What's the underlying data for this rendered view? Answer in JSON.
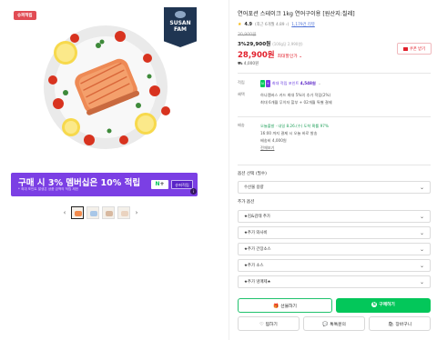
{
  "gallery": {
    "super_badge": "슈퍼적립",
    "brand_line1": "SUSAN",
    "brand_line2": "FAM",
    "promo": {
      "main": "구매 시 3% 멤버십은 10% 적립",
      "sub": "* 최대 포인트 발생은 상품 금액의 적립 제한",
      "n_label": "N",
      "plus_label": "+",
      "chip": "슈퍼적립",
      "info": "i"
    },
    "prev_arrow": "‹",
    "next_arrow": "›"
  },
  "product": {
    "title": "연어포션 스테이크 1kg 연어구이용 [원산지:칠레]",
    "rating_star": "★",
    "rating_value": "4.9",
    "rating_meta": "(최근 6개월 4.89 ›)",
    "review_link": "1,179건 리뷰",
    "original_price": "30,900원",
    "discount_line": "3%29,900원",
    "discount_hint": "(100g당 2,990원)",
    "sale_price": "28,900원",
    "sale_benefit": "최대할인가 ⌄",
    "coupon": "쿠폰 받기",
    "shipping": "4,000원"
  },
  "info": {
    "point_label": "적립",
    "point_plus": "+",
    "point_text": "최대 적립 포인트",
    "point_value": "4,548원",
    "card_label": "혜택",
    "card_line1": "하나멤버스 카드 최대 5%의 추가 적립(2%)",
    "card_line2": "최대 6개월 무이자 할부 + 02개월 특별 결제",
    "delivery_label": "배송",
    "delivery_line1": "오늘출발 · 내일 8.26.(수) 도착 확률 97%",
    "delivery_line2": "16:00 까지 결제 시 오늘 바로 발송",
    "delivery_line3": "배송비 4,000원",
    "delivery_more": "전체보기"
  },
  "options": {
    "required_label": "옵션 선택 (필수)",
    "required_select": "수산물 용량",
    "extra_label": "추가 옵션",
    "extras": [
      "★김&감태 추가",
      "★추가 와사비",
      "★추가 간장소스",
      "★추가 소스",
      "★추가 냉매제★"
    ]
  },
  "actions": {
    "gift": "선물하기",
    "buy": "구매하기",
    "wish": "찜하기",
    "talk": "톡톡문의",
    "cart": "장바구니"
  }
}
